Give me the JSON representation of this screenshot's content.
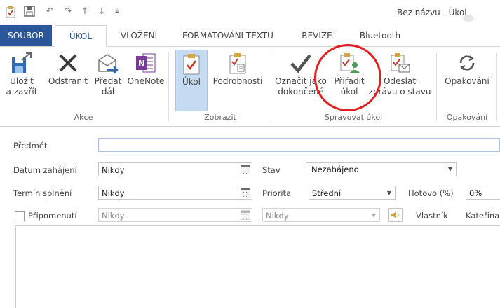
{
  "quick_access": {
    "icons": [
      "task-icon",
      "save-icon",
      "undo-icon",
      "redo-icon",
      "up-icon",
      "down-icon",
      "customize-icon"
    ]
  },
  "window_title": "Bez názvu - Úkol",
  "tabs": [
    {
      "label": "SOUBOR"
    },
    {
      "label": "ÚKOL"
    },
    {
      "label": "VLOŽENÍ"
    },
    {
      "label": "FORMÁTOVÁNÍ TEXTU"
    },
    {
      "label": "REVIZE"
    },
    {
      "label": "Bluetooth"
    }
  ],
  "ribbon": {
    "groups": [
      {
        "label": "Akce"
      },
      {
        "label": "Zobrazit"
      },
      {
        "label": "Spravovat úkol"
      },
      {
        "label": "Opakování"
      }
    ],
    "buttons": {
      "save_close": {
        "line1": "Uložit",
        "line2": "a zavřít"
      },
      "delete": {
        "line1": "Odstranit",
        "line2": ""
      },
      "forward": {
        "line1": "Předat",
        "line2": "dál"
      },
      "onenote": {
        "line1": "OneNote",
        "line2": ""
      },
      "task": {
        "line1": "Úkol",
        "line2": ""
      },
      "details": {
        "line1": "Podrobnosti",
        "line2": ""
      },
      "mark_complete": {
        "line1": "Označit jako",
        "line2": "dokončené"
      },
      "assign": {
        "line1": "Přiřadit",
        "line2": "úkol"
      },
      "send_status": {
        "line1": "Odeslat",
        "line2": "zprávu o stavu"
      },
      "recurrence": {
        "line1": "Opakování",
        "line2": ""
      }
    }
  },
  "form": {
    "subject_label": "Předmět",
    "subject_value": "",
    "start_label": "Datum zahájení",
    "start_value": "Nikdy",
    "due_label": "Termín splnění",
    "due_value": "Nikdy",
    "reminder_label": "Připomenutí",
    "reminder_date": "Nikdy",
    "reminder_time": "Nikdy",
    "status_label": "Stav",
    "status_value": "Nezahájeno",
    "priority_label": "Priorita",
    "priority_value": "Střední",
    "complete_label": "Hotovo (%)",
    "complete_value": "0%",
    "owner_label": "Vlastník",
    "owner_value": "Kateřina"
  },
  "colors": {
    "accent": "#2b579a",
    "highlight": "#c5dbf1",
    "annotation": "#e02020"
  }
}
